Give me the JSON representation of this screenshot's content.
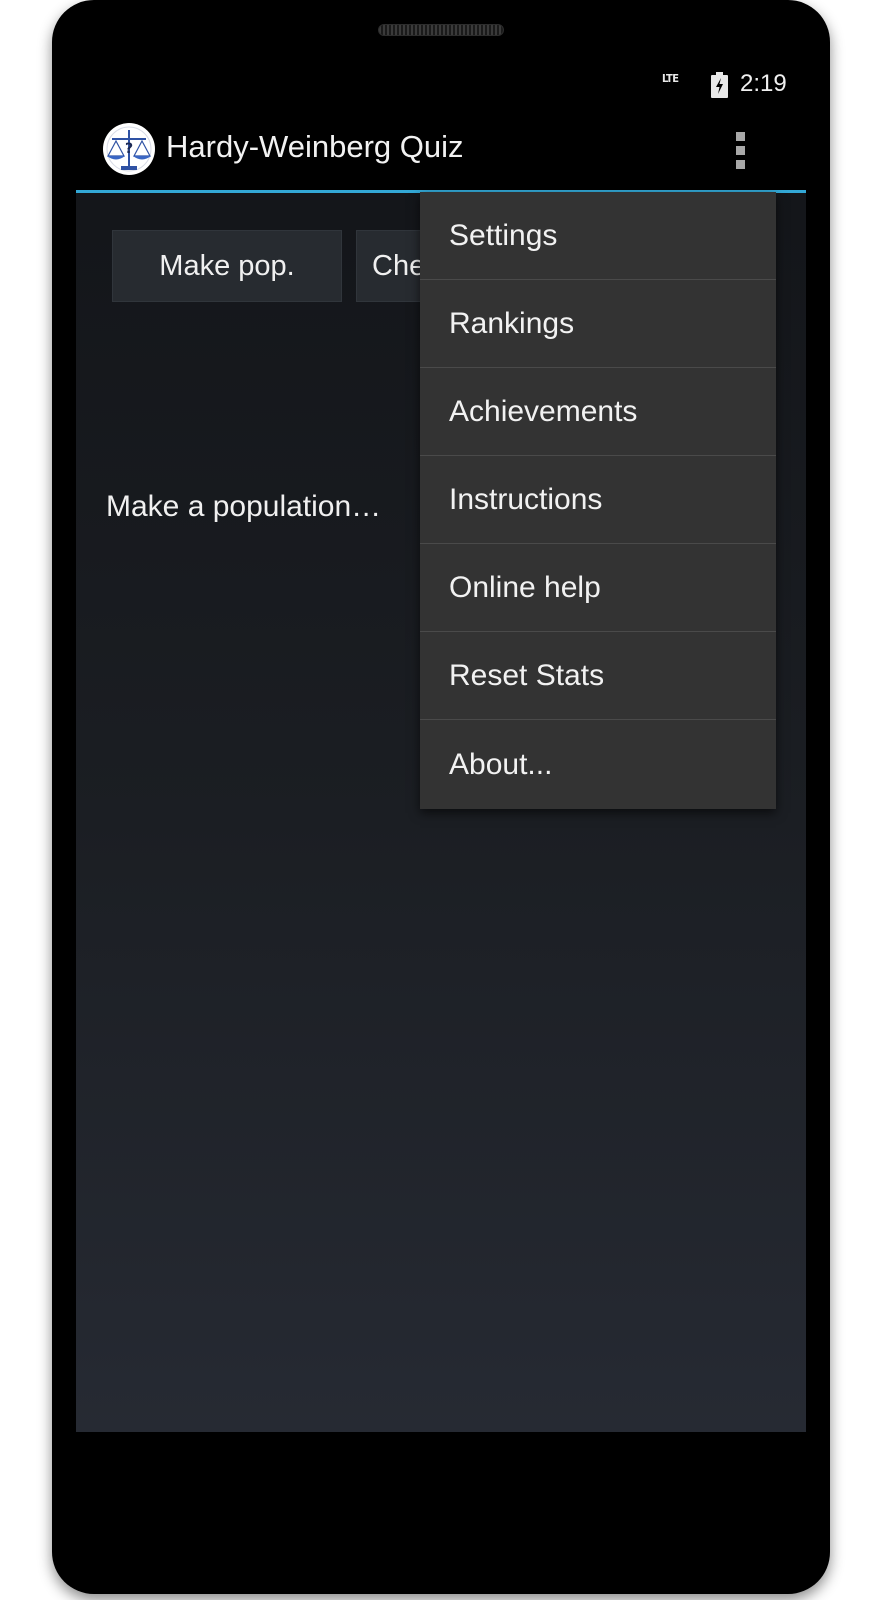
{
  "status_bar": {
    "network": "LTE",
    "battery_icon": "battery-charging-icon",
    "time": "2:19"
  },
  "action_bar": {
    "icon": "scales-question-icon",
    "title": "Hardy-Weinberg Quiz",
    "overflow_icon": "overflow-menu-icon",
    "accent_color": "#33a8d6"
  },
  "buttons": {
    "make_pop": "Make pop.",
    "check": "Che"
  },
  "main": {
    "prompt": "Make a population…"
  },
  "menu": {
    "items": [
      {
        "label": "Settings"
      },
      {
        "label": "Rankings"
      },
      {
        "label": "Achievements"
      },
      {
        "label": "Instructions"
      },
      {
        "label": "Online help"
      },
      {
        "label": "Reset Stats"
      },
      {
        "label": "About..."
      }
    ]
  }
}
